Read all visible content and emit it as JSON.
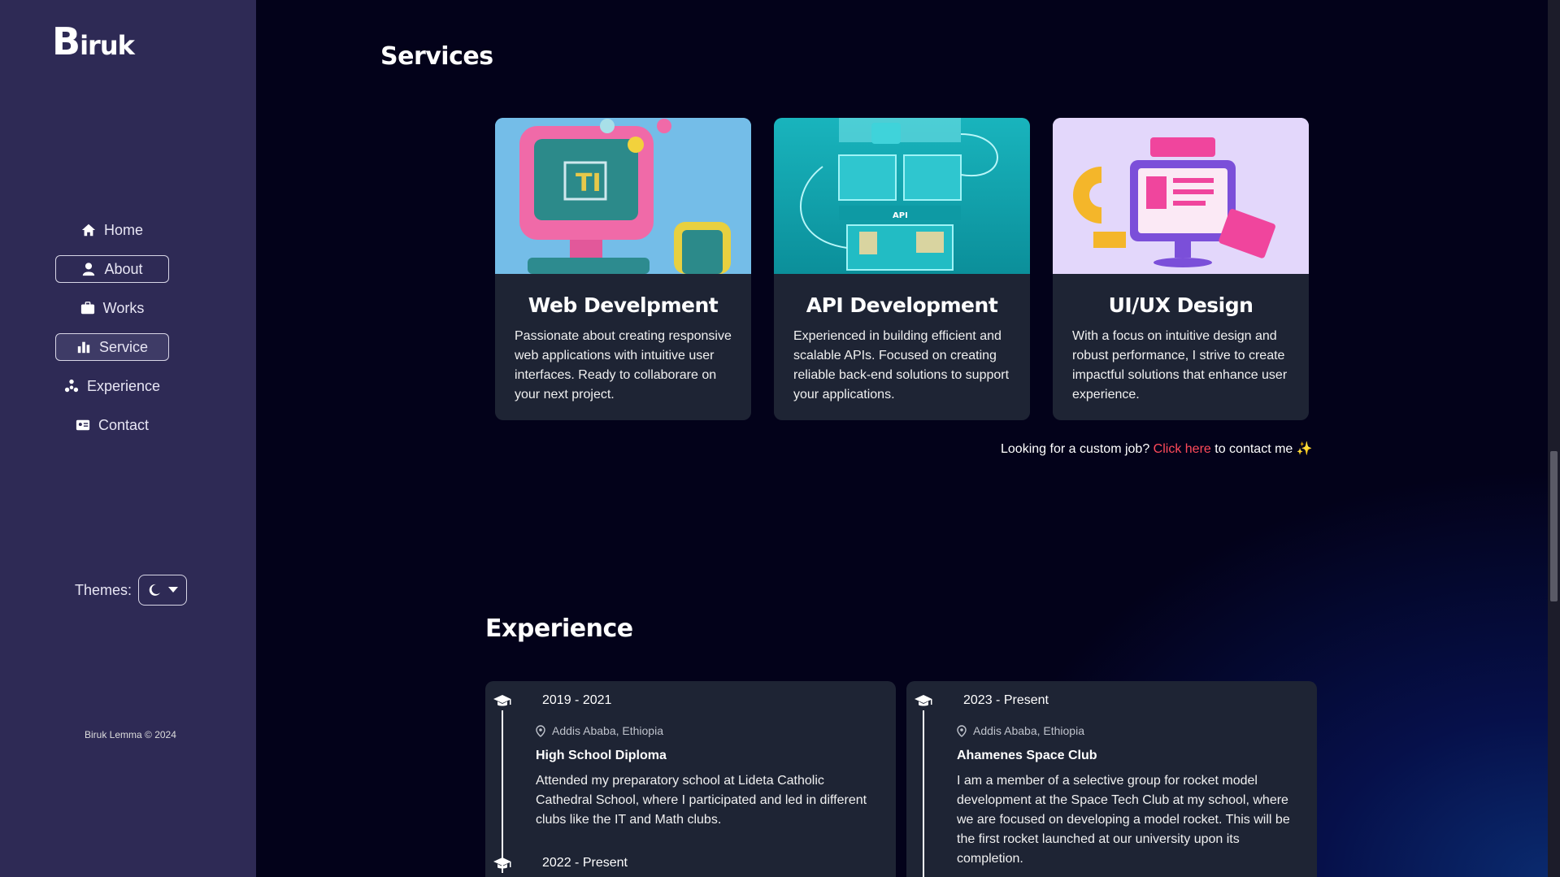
{
  "sidebar": {
    "logo": "Biruk",
    "nav": [
      {
        "label": "Home",
        "icon": "home-icon"
      },
      {
        "label": "About",
        "icon": "user-icon"
      },
      {
        "label": "Works",
        "icon": "briefcase-icon"
      },
      {
        "label": "Service",
        "icon": "bar-chart-icon"
      },
      {
        "label": "Experience",
        "icon": "sitemap-icon"
      },
      {
        "label": "Contact",
        "icon": "contact-card-icon"
      }
    ],
    "themes_label": "Themes:",
    "theme_icon": "moon-icon",
    "copyright": "Biruk Lemma © 2024"
  },
  "services": {
    "title": "Services",
    "cards": [
      {
        "title": "Web Develpment",
        "desc": "Passionate about creating responsive web applications with intuitive user interfaces. Ready to collaborare on your next project."
      },
      {
        "title": "API Development",
        "desc": "Experienced in building efficient and scalable APIs. Focused on creating reliable back-end solutions to support your applications.",
        "img_label": "API"
      },
      {
        "title": "UI/UX Design",
        "desc": "With a focus on intuitive design and robust performance, I strive to create impactful solutions that enhance user experience."
      }
    ],
    "cta_before": "Looking for a custom job?",
    "cta_link": "Click here",
    "cta_after": "to contact me ✨"
  },
  "experience": {
    "title": "Experience",
    "left": [
      {
        "date": "2019 - 2021",
        "location": "Addis Ababa, Ethiopia",
        "title": "High School Diploma",
        "desc": "Attended my preparatory school at Lideta Catholic Cathedral School, where I participated and led in different clubs like the IT and Math clubs."
      },
      {
        "date": "2022 - Present"
      }
    ],
    "right": [
      {
        "date": "2023 - Present",
        "location": "Addis Ababa, Ethiopia",
        "title": "Ahamenes Space Club",
        "desc": "I am a member of a selective group for rocket model development at the Space Tech Club at my school, where we are focused on developing a model rocket. This will be the first rocket launched at our university upon its completion."
      }
    ]
  }
}
